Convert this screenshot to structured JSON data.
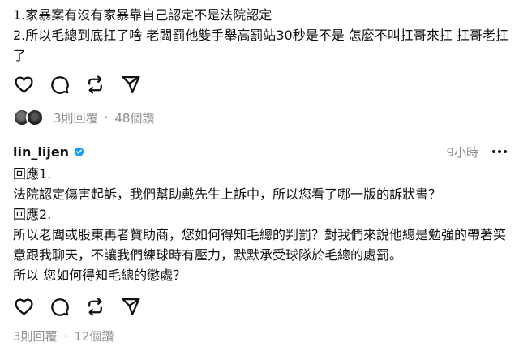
{
  "post1": {
    "lines": [
      "1.家暴案有沒有家暴靠自己認定不是法院認定",
      "2.所以毛總到底扛了啥 老闆罰他雙手舉高罰站30秒是不是 怎麼不叫扛哥來扛 扛哥老扛了"
    ],
    "actions": [
      {
        "name": "like-icon",
        "icon": "heart"
      },
      {
        "name": "comment-icon",
        "icon": "speech-bubble"
      },
      {
        "name": "repost-icon",
        "icon": "repost-arrows"
      },
      {
        "name": "share-icon",
        "icon": "paper-plane"
      }
    ],
    "replies": "3則回覆",
    "separator": "·",
    "views": "48個讚"
  },
  "post2": {
    "username": "lin_lijen",
    "verified_color": "#1d9bf0",
    "timestamp": "9小時",
    "lines": [
      "回應1.",
      "法院認定傷害起訴，我們幫助戴先生上訴中，所以您看了哪一版的訴狀書？",
      "回應2.",
      "所以老闆或股東再者贊助商，您如何得知毛總的判罰？對我們來說他總是勉強的帶著笑意跟我聊天，不讓我們練球時有壓力，默默承受球隊於毛總的處罰。",
      "所以 您如何得知毛總的懲處？"
    ],
    "replies": "3則回覆",
    "separator": "·",
    "views": "12個讚"
  }
}
